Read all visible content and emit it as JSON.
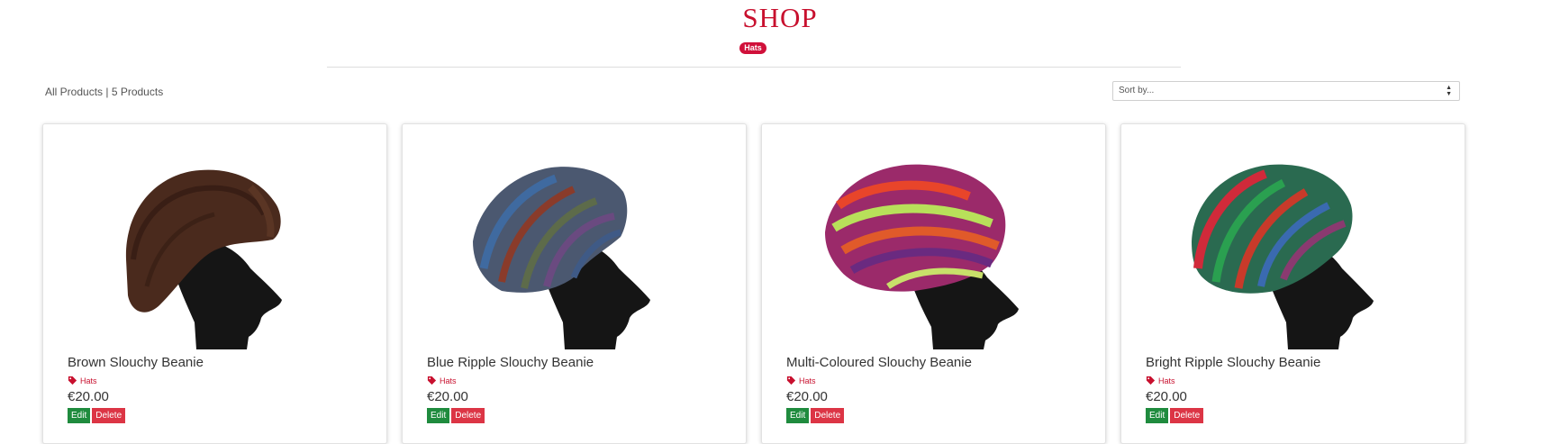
{
  "header": {
    "title": "SHOP",
    "category_badge": "Hats"
  },
  "toolbar": {
    "all_products": "All Products",
    "separator": " | ",
    "product_count": "5 Products",
    "sort_placeholder": "Sort by..."
  },
  "colors": {
    "brand": "#c8102e",
    "edit": "#1f8b3e",
    "delete": "#dc3545"
  },
  "products": [
    {
      "name": "Brown Slouchy Beanie",
      "category": "Hats",
      "price": "€20.00",
      "edit_label": "Edit",
      "delete_label": "Delete"
    },
    {
      "name": "Blue Ripple Slouchy Beanie",
      "category": "Hats",
      "price": "€20.00",
      "edit_label": "Edit",
      "delete_label": "Delete"
    },
    {
      "name": "Multi-Coloured Slouchy Beanie",
      "category": "Hats",
      "price": "€20.00",
      "edit_label": "Edit",
      "delete_label": "Delete"
    },
    {
      "name": "Bright Ripple Slouchy Beanie",
      "category": "Hats",
      "price": "€20.00",
      "edit_label": "Edit",
      "delete_label": "Delete"
    }
  ]
}
